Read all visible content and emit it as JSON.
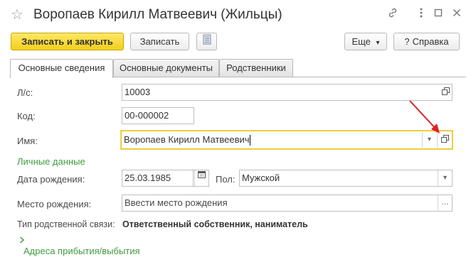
{
  "window": {
    "title": "Воропаев Кирилл Матвеевич (Жильцы)",
    "icons": [
      "star-icon",
      "link-icon",
      "more-icon",
      "maximize-icon",
      "close-icon"
    ]
  },
  "toolbar": {
    "save_close_label": "Записать и закрыть",
    "save_label": "Записать",
    "more_label": "Еще",
    "help_label": "Справка",
    "help_prefix": "?",
    "dropdown_arrow": "▾"
  },
  "tabs": [
    {
      "label": "Основные сведения",
      "active": true
    },
    {
      "label": "Основные документы",
      "active": false
    },
    {
      "label": "Родственники",
      "active": false
    }
  ],
  "form": {
    "account_label": "Л/с:",
    "account_value": "10003",
    "code_label": "Код:",
    "code_value": "00-000002",
    "name_label": "Имя:",
    "name_value": "Воропаев Кирилл Матвеевич",
    "personal_section": "Личные данные",
    "birth_date_label": "Дата рождения:",
    "birth_date_value": "25.03.1985",
    "gender_label": "Пол:",
    "gender_value": "Мужской",
    "birth_place_label": "Место рождения:",
    "birth_place_value": "Ввести место рождения",
    "relation_label": "Тип родственной связи:",
    "relation_value": "Ответственный собственник, наниматель",
    "address_section": "Адреса прибытия/выбытия",
    "ellipsis": "..."
  },
  "colors": {
    "primary_button": "#f3cf1c",
    "section_green": "#3f9b3f",
    "focus_border": "#e6c328",
    "annotation_arrow": "#e02020"
  }
}
